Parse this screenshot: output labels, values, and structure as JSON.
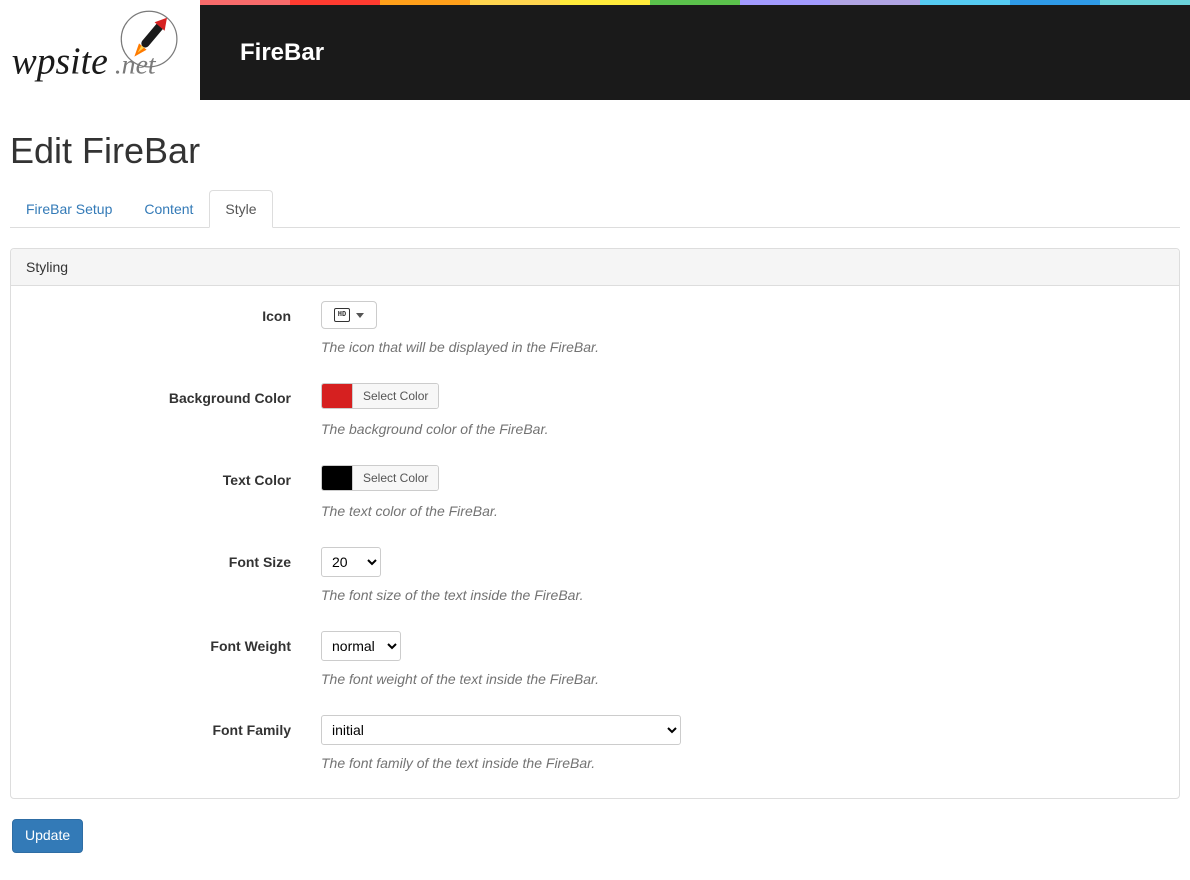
{
  "header": {
    "logo_text_main": "wpsite",
    "logo_text_tld": ".net",
    "title": "FireBar",
    "rainbow_colors": [
      "#f86b6b",
      "#ff3b30",
      "#ff9f1a",
      "#ffd54f",
      "#ffeb3b",
      "#5bc24c",
      "#a29bfe",
      "#b0a4e3",
      "#55cbf2",
      "#2f9be8",
      "#6bd3db"
    ]
  },
  "page": {
    "title": "Edit FireBar"
  },
  "tabs": [
    {
      "label": "FireBar Setup",
      "active": false
    },
    {
      "label": "Content",
      "active": false
    },
    {
      "label": "Style",
      "active": true
    }
  ],
  "panel": {
    "heading": "Styling"
  },
  "fields": {
    "icon": {
      "label": "Icon",
      "glyph": "HD",
      "help": "The icon that will be displayed in the FireBar."
    },
    "background_color": {
      "label": "Background Color",
      "value": "#d62020",
      "button_label": "Select Color",
      "help": "The background color of the FireBar."
    },
    "text_color": {
      "label": "Text Color",
      "value": "#000000",
      "button_label": "Select Color",
      "help": "The text color of the FireBar."
    },
    "font_size": {
      "label": "Font Size",
      "value": "20",
      "help": "The font size of the text inside the FireBar."
    },
    "font_weight": {
      "label": "Font Weight",
      "value": "normal",
      "help": "The font weight of the text inside the FireBar."
    },
    "font_family": {
      "label": "Font Family",
      "value": "initial",
      "help": "The font family of the text inside the FireBar."
    }
  },
  "actions": {
    "submit": "Update"
  }
}
